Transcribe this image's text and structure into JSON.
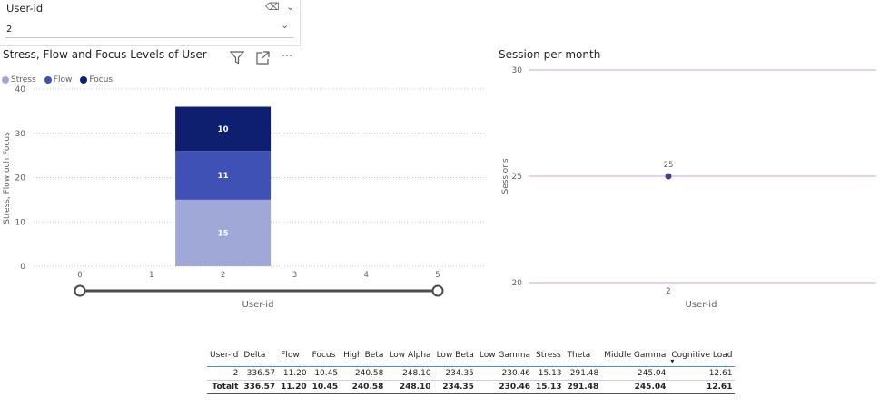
{
  "slicer": {
    "title": "User-id",
    "value": "2",
    "icons": [
      "eraser-icon",
      "chevron-down-icon"
    ]
  },
  "left_visual": {
    "title": "Stress, Flow and Focus Levels of User",
    "toolbar_icons": [
      "filter-icon",
      "focus-mode-icon",
      "more-options-icon"
    ]
  },
  "right_visual": {
    "title": "Session per month"
  },
  "colors": {
    "stress": "#9fa8d6",
    "flow": "#3f51b5",
    "focus": "#0d1f6e",
    "line": "#4a3a8a",
    "ref": "#c9a6d9"
  },
  "chart_data": [
    {
      "type": "bar",
      "stacked": true,
      "xlabel": "User-id",
      "ylabel": "Stress, Flow och Focus",
      "x_ticks": [
        "0",
        "1",
        "2",
        "3",
        "4",
        "5"
      ],
      "y_ticks": [
        "0",
        "10",
        "20",
        "30",
        "40"
      ],
      "ylim": [
        0,
        40
      ],
      "xlim": [
        0,
        5
      ],
      "categories": [
        "2"
      ],
      "series": [
        {
          "name": "Stress",
          "values": [
            15
          ],
          "labels": [
            "15"
          ]
        },
        {
          "name": "Flow",
          "values": [
            11
          ],
          "labels": [
            "11"
          ]
        },
        {
          "name": "Focus",
          "values": [
            10
          ],
          "labels": [
            "10"
          ]
        }
      ],
      "legend": "top-left",
      "grid": true,
      "range_slider": [
        0,
        5
      ]
    },
    {
      "type": "scatter",
      "xlabel": "User-id",
      "ylabel": "Sessions",
      "categories": [
        "2"
      ],
      "values": [
        25
      ],
      "labels": [
        "25"
      ],
      "y_ticks": [
        "20",
        "25",
        "30"
      ],
      "ylim": [
        20,
        30
      ],
      "grid": true
    }
  ],
  "table": {
    "headers": [
      "User-id",
      "Delta",
      "Flow",
      "Focus",
      "High Beta",
      "Low Alpha",
      "Low Beta",
      "Low Gamma",
      "Stress",
      "Theta",
      "Middle Gamma",
      "Cognitive Load"
    ],
    "rows": [
      [
        "2",
        "336.57",
        "11.20",
        "10.45",
        "240.58",
        "248.10",
        "234.35",
        "230.46",
        "15.13",
        "291.48",
        "245.04",
        "12.61"
      ]
    ],
    "total": [
      "Totalt",
      "336.57",
      "11.20",
      "10.45",
      "240.58",
      "248.10",
      "234.35",
      "230.46",
      "15.13",
      "291.48",
      "245.04",
      "12.61"
    ]
  }
}
